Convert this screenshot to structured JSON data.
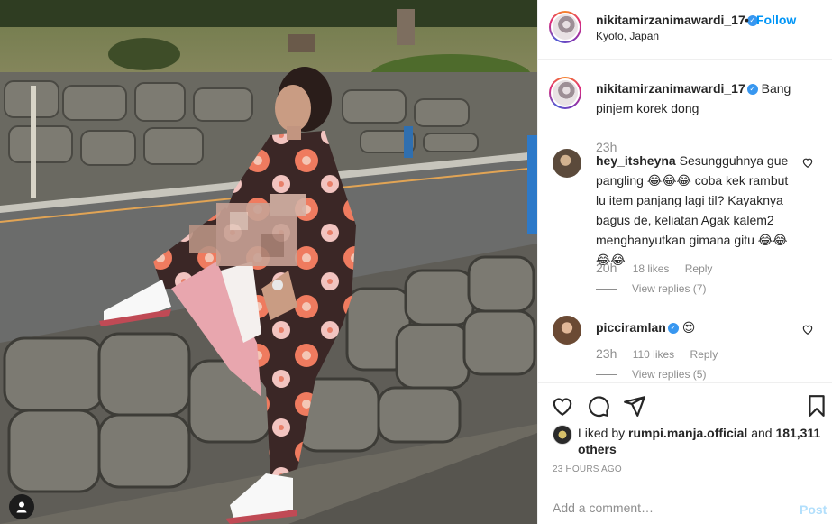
{
  "post": {
    "username": "nikitamirzanimawardi_17",
    "location": "Kyoto, Japan",
    "follow_label": "Follow",
    "separator": "•",
    "verified": true
  },
  "caption": {
    "username": "nikitamirzanimawardi_17",
    "text": "Bang pinjem korek dong",
    "time": "23h"
  },
  "comments": [
    {
      "username": "hey_itsheyna",
      "text": "Sesungguhnya gue pangling 😂😂😂 coba kek rambut lu item panjang lagi til? Kayaknya bagus de, keliatan Agak kalem2 menghanyutkan gimana gitu 😂😂😂😂",
      "time": "20h",
      "likes": "18 likes",
      "reply_label": "Reply",
      "view_replies": "View replies (7)"
    },
    {
      "username": "picciramlan",
      "text": "😍",
      "time": "23h",
      "likes": "110 likes",
      "reply_label": "Reply",
      "view_replies": "View replies (5)"
    }
  ],
  "likes": {
    "prefix": "Liked by",
    "user": "rumpi.manja.official",
    "conjunction": "and",
    "count": "181,311 others"
  },
  "post_age": "23 HOURS AGO",
  "add_comment": {
    "placeholder": "Add a comment…",
    "post_label": "Post"
  },
  "icons": {
    "like": "heart-icon",
    "comment": "comment-icon",
    "share": "send-icon",
    "save": "bookmark-icon",
    "user_tag": "user-tag-icon"
  },
  "colors": {
    "accent": "#0095f6",
    "verified": "#3897f0",
    "muted": "#8e8e8e",
    "text": "#262626",
    "border": "#efefef",
    "post_disabled": "#b2dffc"
  }
}
